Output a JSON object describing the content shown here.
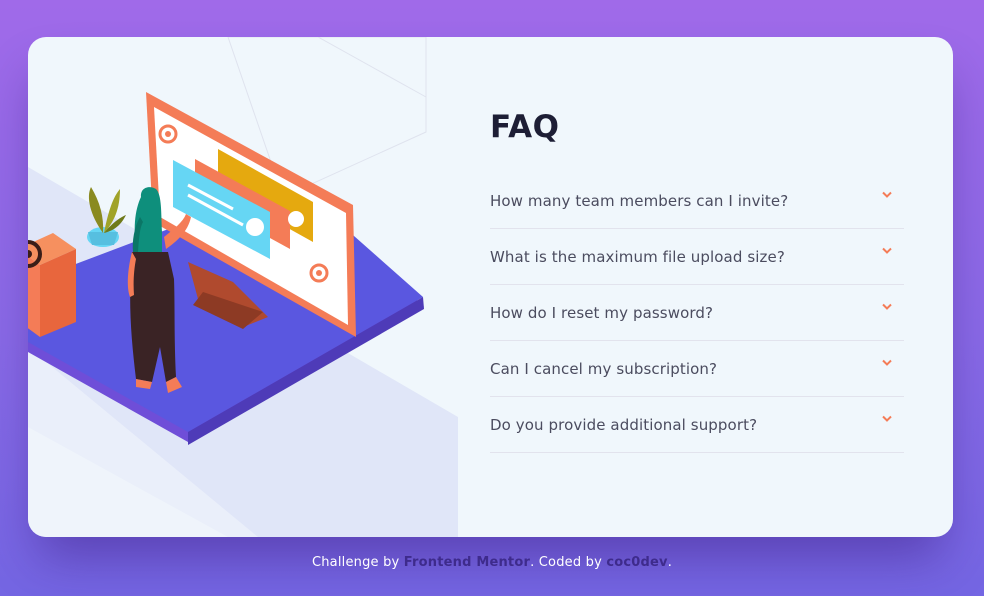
{
  "faq": {
    "title": "FAQ",
    "items": [
      {
        "question": "How many team members can I invite?"
      },
      {
        "question": "What is the maximum file upload size?"
      },
      {
        "question": "How do I reset my password?"
      },
      {
        "question": "Can I cancel my subscription?"
      },
      {
        "question": "Do you provide additional support?"
      }
    ]
  },
  "footer": {
    "prefix": "Challenge by ",
    "link1": "Frontend Mentor",
    "middle": ". Coded by ",
    "link2": "coc0dev",
    "suffix": "."
  },
  "colors": {
    "accent": "#f47c57",
    "title": "#1d1e35",
    "text": "#4b4c5f",
    "card": "#f0f7fc",
    "link": "#3e2b8c"
  },
  "icons": [
    "at-sign-icon",
    "chevron-down-icon",
    "plant-icon"
  ]
}
